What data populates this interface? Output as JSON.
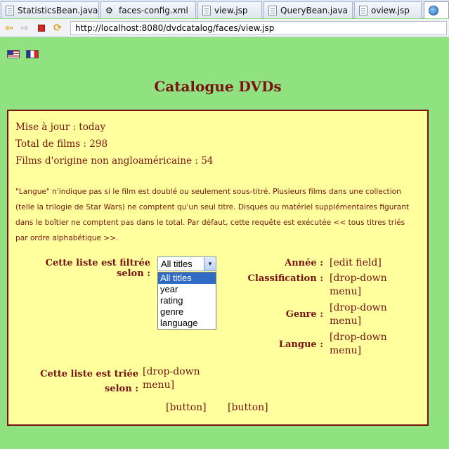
{
  "tabs": [
    {
      "label": "StatisticsBean.java",
      "icon": "java-file-icon"
    },
    {
      "label": "faces-config.xml",
      "icon": "xml-config-icon"
    },
    {
      "label": "view.jsp",
      "icon": "jsp-file-icon"
    },
    {
      "label": "QueryBean.java",
      "icon": "java-file-icon"
    },
    {
      "label": "oview.jsp",
      "icon": "jsp-file-icon"
    }
  ],
  "address": {
    "url": "http://localhost:8080/dvdcatalog/faces/view.jsp"
  },
  "page": {
    "title": "Catalogue DVDs",
    "stats": {
      "updated": "Mise à jour : today",
      "total": "Total de films : 298",
      "non_anglo": "Films d'origine non angloaméricaine : 54"
    },
    "note": "\"Langue\" n'indique pas si le film est doublé ou seulement sous-titré.  Plusieurs films dans une collection (telle la trilogie de Star Wars) ne comptent qu'un seul titre. Disques ou matériel supplémentaires figurant dans le boîtier ne comptent pas dans le total.  Par défaut, cette requête est exécutée << tous titres triés par ordre alphabétique >>.",
    "filter": {
      "label": "Cette liste est filtrée selon :",
      "selected": "All titles",
      "options": [
        "All titles",
        "year",
        "rating",
        "genre",
        "language"
      ]
    },
    "fields": {
      "annee_label": "Année :",
      "annee_value": "[edit field]",
      "classification_label": "Classification :",
      "classification_value": "[drop-down menu]",
      "genre_label": "Genre :",
      "genre_value": "[drop-down menu]",
      "langue_label": "Langue :",
      "langue_value": "[drop-down menu]"
    },
    "sort": {
      "label_line1": "Cette liste est triée",
      "label_line2": "selon :",
      "value": "[drop-down menu]"
    },
    "buttons": {
      "first": "[button]",
      "second": "[button]"
    }
  },
  "colors": {
    "page_bg": "#8fe27f",
    "panel_bg": "#ffff9e",
    "text": "#7a1212"
  }
}
